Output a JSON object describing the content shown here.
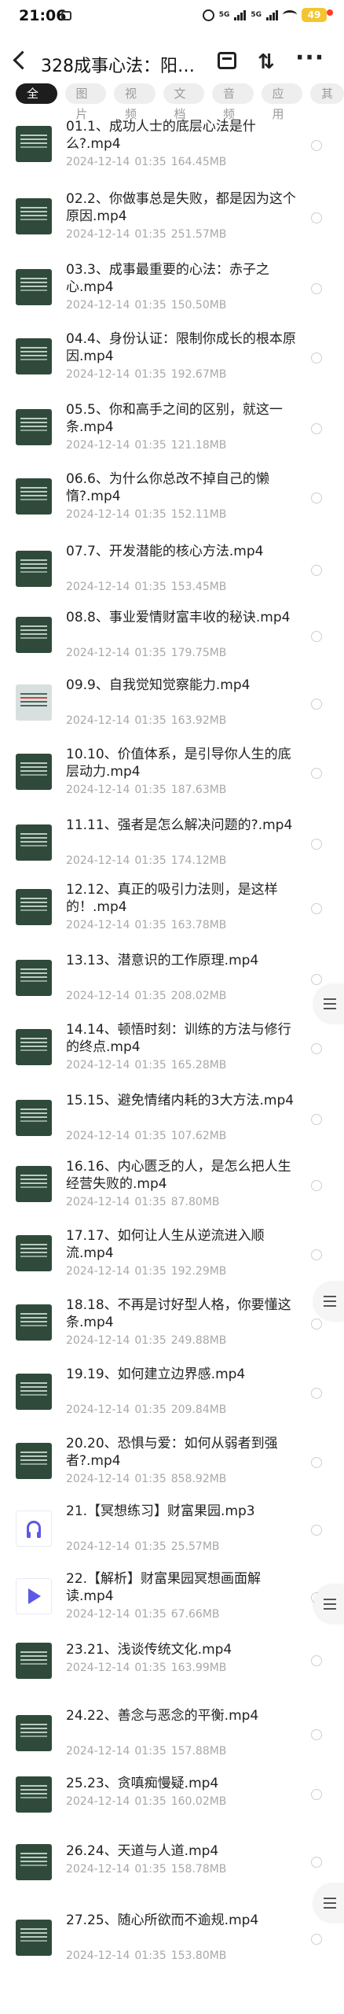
{
  "status": {
    "time": "21:06",
    "net_label": "5G",
    "battery": "49"
  },
  "header": {
    "title": "328成事心法：阳…"
  },
  "tabs": [
    "全部",
    "图片",
    "视频",
    "文档",
    "音频",
    "应用",
    "其"
  ],
  "files": [
    {
      "name": "01.1、成功人士的底层心法是什么?.mp4",
      "date": "2024-12-14",
      "time": "01:35",
      "size": "164.45MB",
      "thumb": "slide"
    },
    {
      "name": "02.2、你做事总是失败，都是因为这个原因.mp4",
      "date": "2024-12-14",
      "time": "01:35",
      "size": "251.57MB",
      "thumb": "slide"
    },
    {
      "name": "03.3、成事最重要的心法：赤子之心.mp4",
      "date": "2024-12-14",
      "time": "01:35",
      "size": "150.50MB",
      "thumb": "slide"
    },
    {
      "name": "04.4、身份认证：限制你成长的根本原因.mp4",
      "date": "2024-12-14",
      "time": "01:35",
      "size": "192.67MB",
      "thumb": "slide"
    },
    {
      "name": "05.5、你和高手之间的区别，就这一条.mp4",
      "date": "2024-12-14",
      "time": "01:35",
      "size": "121.18MB",
      "thumb": "slide"
    },
    {
      "name": "06.6、为什么你总改不掉自己的懒惰?.mp4",
      "date": "2024-12-14",
      "time": "01:35",
      "size": "152.11MB",
      "thumb": "slide"
    },
    {
      "name": "07.7、开发潜能的核心方法.mp4",
      "date": "2024-12-14",
      "time": "01:35",
      "size": "153.45MB",
      "thumb": "slide"
    },
    {
      "name": "08.8、事业爱情财富丰收的秘诀.mp4",
      "date": "2024-12-14",
      "time": "01:35",
      "size": "179.75MB",
      "thumb": "slide"
    },
    {
      "name": "09.9、自我觉知觉察能力.mp4",
      "date": "2024-12-14",
      "time": "01:35",
      "size": "163.92MB",
      "thumb": "light"
    },
    {
      "name": "10.10、价值体系，是引导你人生的底层动力.mp4",
      "date": "2024-12-14",
      "time": "01:35",
      "size": "187.63MB",
      "thumb": "slide"
    },
    {
      "name": "11.11、强者是怎么解决问题的?.mp4",
      "date": "2024-12-14",
      "time": "01:35",
      "size": "174.12MB",
      "thumb": "slide"
    },
    {
      "name": "12.12、真正的吸引力法则，是这样的！.mp4",
      "date": "2024-12-14",
      "time": "01:35",
      "size": "163.78MB",
      "thumb": "slide"
    },
    {
      "name": "13.13、潜意识的工作原理.mp4",
      "date": "2024-12-14",
      "time": "01:35",
      "size": "208.02MB",
      "thumb": "slide"
    },
    {
      "name": "14.14、顿悟时刻：训练的方法与修行的终点.mp4",
      "date": "2024-12-14",
      "time": "01:35",
      "size": "165.28MB",
      "thumb": "slide"
    },
    {
      "name": "15.15、避免情绪内耗的3大方法.mp4",
      "date": "2024-12-14",
      "time": "01:35",
      "size": "107.62MB",
      "thumb": "slide"
    },
    {
      "name": "16.16、内心匮乏的人，是怎么把人生经营失败的.mp4",
      "date": "2024-12-14",
      "time": "01:35",
      "size": "87.80MB",
      "thumb": "slide"
    },
    {
      "name": "17.17、如何让人生从逆流进入顺流.mp4",
      "date": "2024-12-14",
      "time": "01:35",
      "size": "192.29MB",
      "thumb": "slide"
    },
    {
      "name": "18.18、不再是讨好型人格，你要懂这条.mp4",
      "date": "2024-12-14",
      "time": "01:35",
      "size": "249.88MB",
      "thumb": "slide"
    },
    {
      "name": "19.19、如何建立边界感.mp4",
      "date": "2024-12-14",
      "time": "01:35",
      "size": "209.84MB",
      "thumb": "slide"
    },
    {
      "name": "20.20、恐惧与爱：如何从弱者到强者?.mp4",
      "date": "2024-12-14",
      "time": "01:35",
      "size": "858.92MB",
      "thumb": "slide"
    },
    {
      "name": "21.【冥想练习】财富果园.mp3",
      "date": "2024-12-14",
      "time": "01:35",
      "size": "25.57MB",
      "thumb": "audio"
    },
    {
      "name": "22.【解析】财富果园冥想画面解读.mp4",
      "date": "2024-12-14",
      "time": "01:35",
      "size": "67.66MB",
      "thumb": "video"
    },
    {
      "name": "23.21、浅谈传统文化.mp4",
      "date": "2024-12-14",
      "time": "01:35",
      "size": "163.99MB",
      "thumb": "slide"
    },
    {
      "name": "24.22、善念与恶念的平衡.mp4",
      "date": "2024-12-14",
      "time": "01:35",
      "size": "157.88MB",
      "thumb": "slide"
    },
    {
      "name": "25.23、贪嗔痴慢疑.mp4",
      "date": "2024-12-14",
      "time": "01:35",
      "size": "160.02MB",
      "thumb": "slide"
    },
    {
      "name": "26.24、天道与人道.mp4",
      "date": "2024-12-14",
      "time": "01:35",
      "size": "158.78MB",
      "thumb": "slide"
    },
    {
      "name": "27.25、随心所欲而不逾规.mp4",
      "date": "2024-12-14",
      "time": "01:35",
      "size": "153.80MB",
      "thumb": "slide"
    }
  ]
}
